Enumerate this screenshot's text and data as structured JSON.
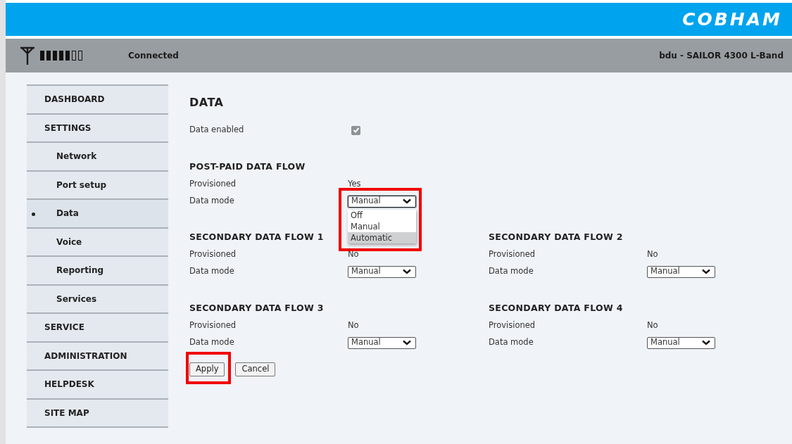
{
  "header": {
    "logo": "COBHAM",
    "connection_status": "Connected",
    "device_name": "bdu - SAILOR 4300 L-Band"
  },
  "sidebar": {
    "items": [
      {
        "label": "DASHBOARD",
        "selected": false
      },
      {
        "label": "SETTINGS",
        "selected": false,
        "children": [
          {
            "label": "Network",
            "selected": false
          },
          {
            "label": "Port setup",
            "selected": false
          },
          {
            "label": "Data",
            "selected": true
          },
          {
            "label": "Voice",
            "selected": false
          },
          {
            "label": "Reporting",
            "selected": false
          },
          {
            "label": "Services",
            "selected": false
          }
        ]
      },
      {
        "label": "SERVICE",
        "selected": false
      },
      {
        "label": "ADMINISTRATION",
        "selected": false
      },
      {
        "label": "HELPDESK",
        "selected": false
      },
      {
        "label": "SITE MAP",
        "selected": false
      }
    ]
  },
  "page": {
    "title": "DATA",
    "data_enabled": {
      "label": "Data enabled",
      "checked": true
    },
    "flows": [
      {
        "title": "POST-PAID DATA FLOW",
        "provisioned_label": "Provisioned",
        "provisioned": "Yes",
        "mode_label": "Data mode",
        "mode": "Manual",
        "expanded": true,
        "annotated": true,
        "options": [
          {
            "label": "Off",
            "selected": false
          },
          {
            "label": "Manual",
            "selected": false
          },
          {
            "label": "Automatic",
            "selected": true
          }
        ]
      },
      {
        "title": "SECONDARY DATA FLOW 1",
        "provisioned_label": "Provisioned",
        "provisioned": "No",
        "mode_label": "Data mode",
        "mode": "Manual"
      },
      {
        "title": "SECONDARY DATA FLOW 2",
        "provisioned_label": "Provisioned",
        "provisioned": "No",
        "mode_label": "Data mode",
        "mode": "Manual"
      },
      {
        "title": "SECONDARY DATA FLOW 3",
        "provisioned_label": "Provisioned",
        "provisioned": "No",
        "mode_label": "Data mode",
        "mode": "Manual"
      },
      {
        "title": "SECONDARY DATA FLOW 4",
        "provisioned_label": "Provisioned",
        "provisioned": "No",
        "mode_label": "Data mode",
        "mode": "Manual"
      }
    ],
    "buttons": [
      {
        "label": "Apply",
        "annotated": true
      },
      {
        "label": "Cancel"
      }
    ]
  }
}
